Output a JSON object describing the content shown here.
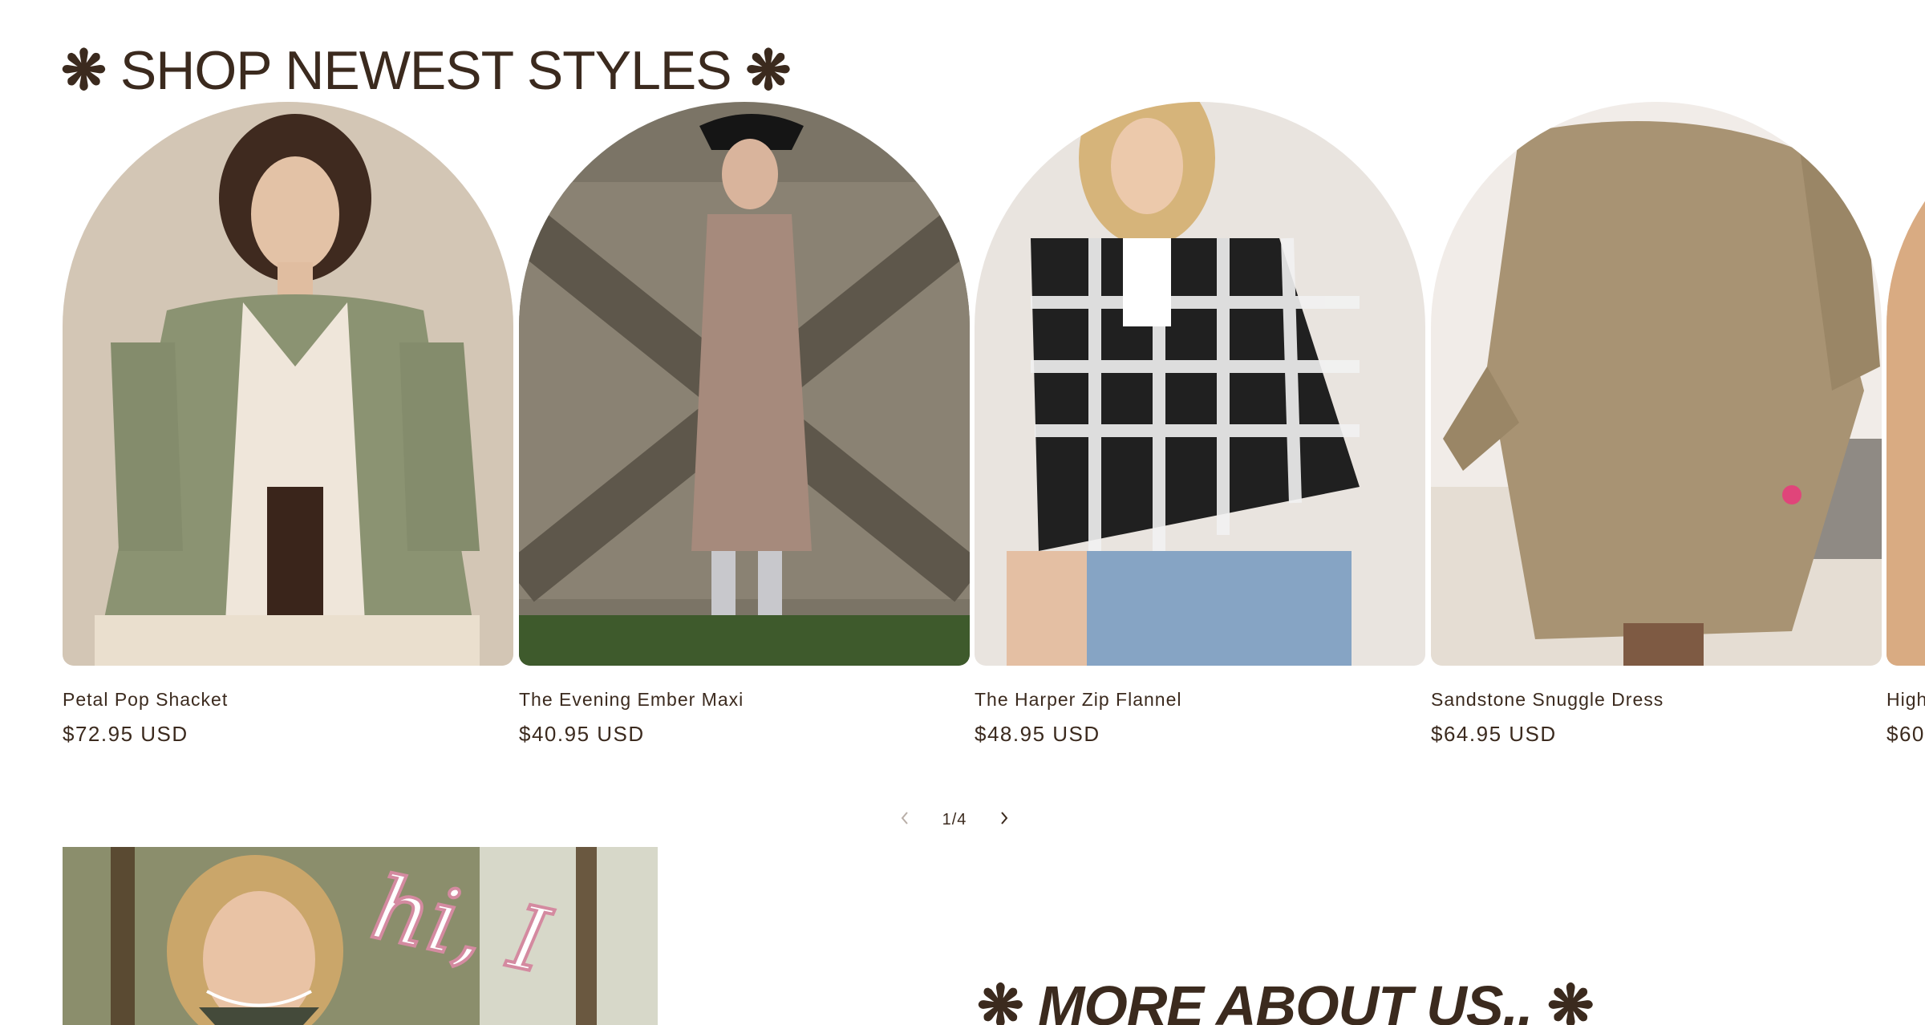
{
  "section": {
    "title": "SHOP NEWEST STYLES",
    "star_icon": "asterisk-flower-icon"
  },
  "products": [
    {
      "name": "Petal Pop Shacket",
      "price": "$72.95 USD"
    },
    {
      "name": "The Evening Ember Maxi",
      "price": "$40.95 USD"
    },
    {
      "name": "The Harper Zip Flannel",
      "price": "$48.95 USD"
    },
    {
      "name": "Sandstone Snuggle Dress",
      "price": "$64.95 USD"
    },
    {
      "name": "High",
      "price": "$60"
    }
  ],
  "pager": {
    "count": "1/4",
    "prev_icon": "chevron-left-icon",
    "next_icon": "chevron-right-icon"
  },
  "about": {
    "title": "MORE ABOUT US..",
    "photo_caption": "hi, I"
  },
  "colors": {
    "text": "#3b2a1e",
    "background": "#ffffff"
  }
}
